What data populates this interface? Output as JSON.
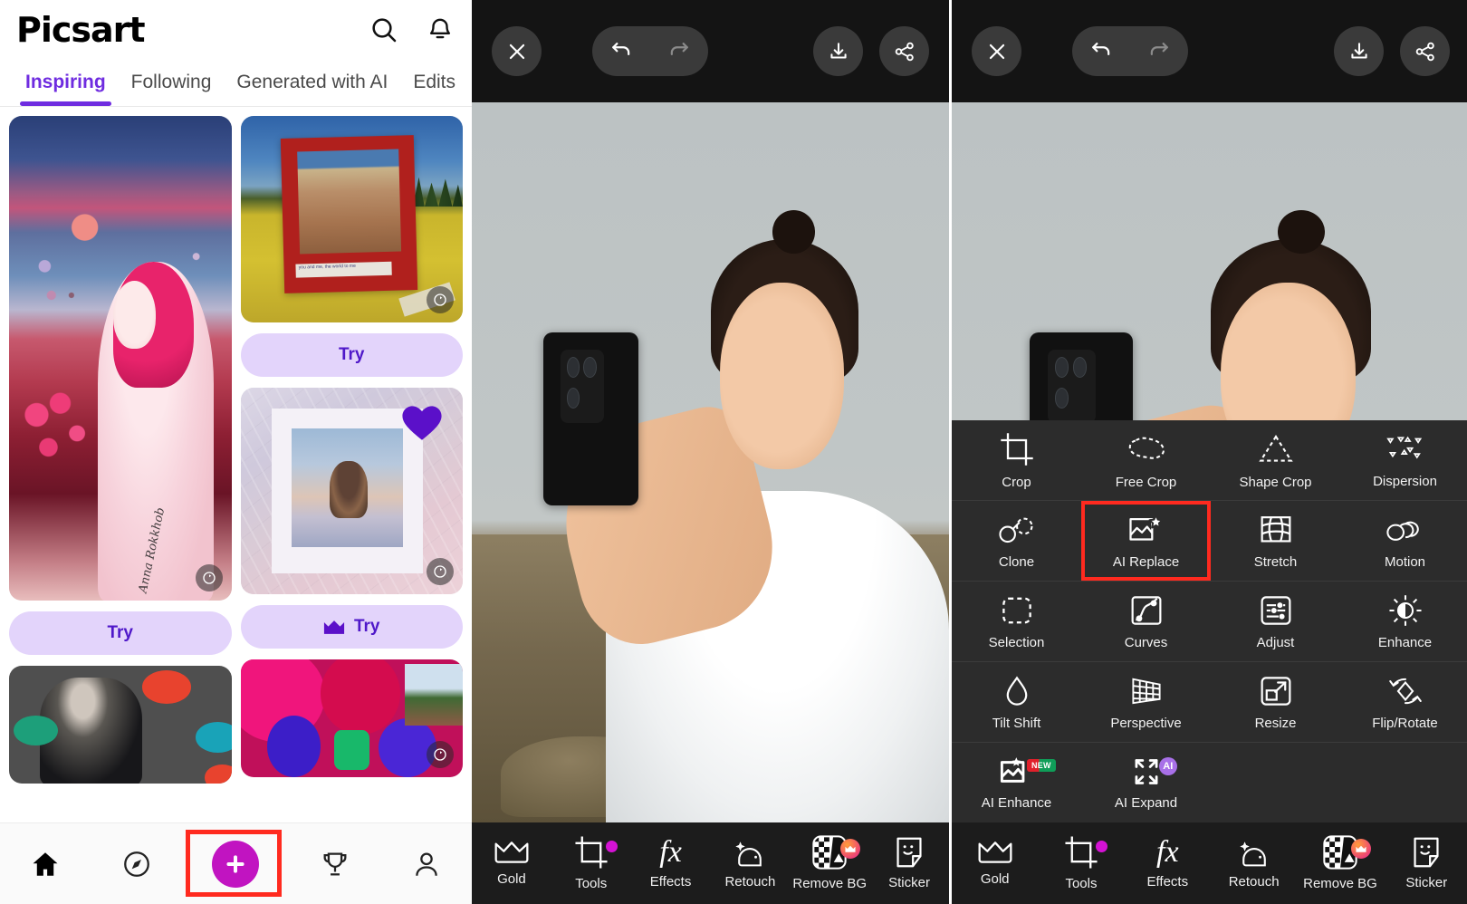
{
  "feed": {
    "logo": "Picsart",
    "icons": {
      "search": "search-icon",
      "notifications": "bell-icon"
    },
    "tabs": [
      {
        "label": "Inspiring",
        "active": true
      },
      {
        "label": "Following",
        "active": false
      },
      {
        "label": "Generated with AI",
        "active": false
      },
      {
        "label": "Edits",
        "active": false
      }
    ],
    "cards": [
      {
        "name": "pink-girl-artwork",
        "try_label": "Try",
        "gold": false,
        "signature": "Anna Rokkhob"
      },
      {
        "name": "field-couple-polaroid",
        "try_label": "Try",
        "gold": false,
        "caption": "you and me, the world to me"
      },
      {
        "name": "crumpled-paper-polaroid",
        "try_label": "Try",
        "gold": true
      },
      {
        "name": "bw-portrait-pompoms",
        "try_label": "",
        "gold": false
      },
      {
        "name": "colorful-collage",
        "try_label": "",
        "gold": false
      }
    ],
    "bottom_nav": [
      {
        "name": "home",
        "label": ""
      },
      {
        "name": "discover",
        "label": ""
      },
      {
        "name": "create",
        "label": ""
      },
      {
        "name": "challenges",
        "label": ""
      },
      {
        "name": "profile",
        "label": ""
      }
    ],
    "highlight_target": "create-button"
  },
  "editor": {
    "topbar": {
      "close": "close-icon",
      "undo": "undo-icon",
      "redo": "redo-icon",
      "download": "download-icon",
      "share": "share-icon"
    },
    "bottom_bar": [
      {
        "label": "Gold",
        "icon": "crown-icon",
        "badge": ""
      },
      {
        "label": "Tools",
        "icon": "crop-icon",
        "badge": "dot"
      },
      {
        "label": "Effects",
        "icon": "fx-icon",
        "badge": ""
      },
      {
        "label": "Retouch",
        "icon": "retouch-icon",
        "badge": ""
      },
      {
        "label": "Remove BG",
        "icon": "removebg-icon",
        "badge": "crown"
      },
      {
        "label": "Sticker",
        "icon": "sticker-icon",
        "badge": ""
      }
    ],
    "tools_grid": [
      [
        {
          "label": "Crop",
          "icon": "crop-icon",
          "selected": false,
          "badge": ""
        },
        {
          "label": "Free Crop",
          "icon": "free-crop-icon",
          "selected": false,
          "badge": ""
        },
        {
          "label": "Shape Crop",
          "icon": "shape-crop-icon",
          "selected": false,
          "badge": ""
        },
        {
          "label": "Dispersion",
          "icon": "dispersion-icon",
          "selected": false,
          "badge": ""
        }
      ],
      [
        {
          "label": "Clone",
          "icon": "clone-icon",
          "selected": false,
          "badge": ""
        },
        {
          "label": "AI Replace",
          "icon": "ai-replace-icon",
          "selected": true,
          "badge": ""
        },
        {
          "label": "Stretch",
          "icon": "stretch-icon",
          "selected": false,
          "badge": ""
        },
        {
          "label": "Motion",
          "icon": "motion-icon",
          "selected": false,
          "badge": ""
        }
      ],
      [
        {
          "label": "Selection",
          "icon": "selection-icon",
          "selected": false,
          "badge": ""
        },
        {
          "label": "Curves",
          "icon": "curves-icon",
          "selected": false,
          "badge": ""
        },
        {
          "label": "Adjust",
          "icon": "adjust-icon",
          "selected": false,
          "badge": ""
        },
        {
          "label": "Enhance",
          "icon": "enhance-icon",
          "selected": false,
          "badge": ""
        }
      ],
      [
        {
          "label": "Tilt Shift",
          "icon": "tilt-shift-icon",
          "selected": false,
          "badge": ""
        },
        {
          "label": "Perspective",
          "icon": "perspective-icon",
          "selected": false,
          "badge": ""
        },
        {
          "label": "Resize",
          "icon": "resize-icon",
          "selected": false,
          "badge": ""
        },
        {
          "label": "Flip/Rotate",
          "icon": "flip-rotate-icon",
          "selected": false,
          "badge": ""
        }
      ],
      [
        {
          "label": "AI Enhance",
          "icon": "ai-enhance-icon",
          "selected": false,
          "badge": "NEW"
        },
        {
          "label": "AI Expand",
          "icon": "ai-expand-icon",
          "selected": false,
          "badge": "AI"
        },
        {
          "label": "",
          "icon": "",
          "selected": false,
          "badge": ""
        },
        {
          "label": "",
          "icon": "",
          "selected": false,
          "badge": ""
        }
      ]
    ],
    "annotations": {
      "arrow_color": "#ff2a1f",
      "arrow_points_to": "Tools",
      "highlight_color": "#ff2a1f",
      "highlight_target": "AI Replace"
    }
  },
  "colors": {
    "brand_purple": "#6f2ce0",
    "try_bg": "#e3d4fb",
    "try_text": "#4f18c9",
    "create_pink": "#c114c1",
    "annotation_red": "#ff2a1f",
    "editor_bg": "#1c1c1c",
    "grid_bg": "#2c2c2c"
  }
}
